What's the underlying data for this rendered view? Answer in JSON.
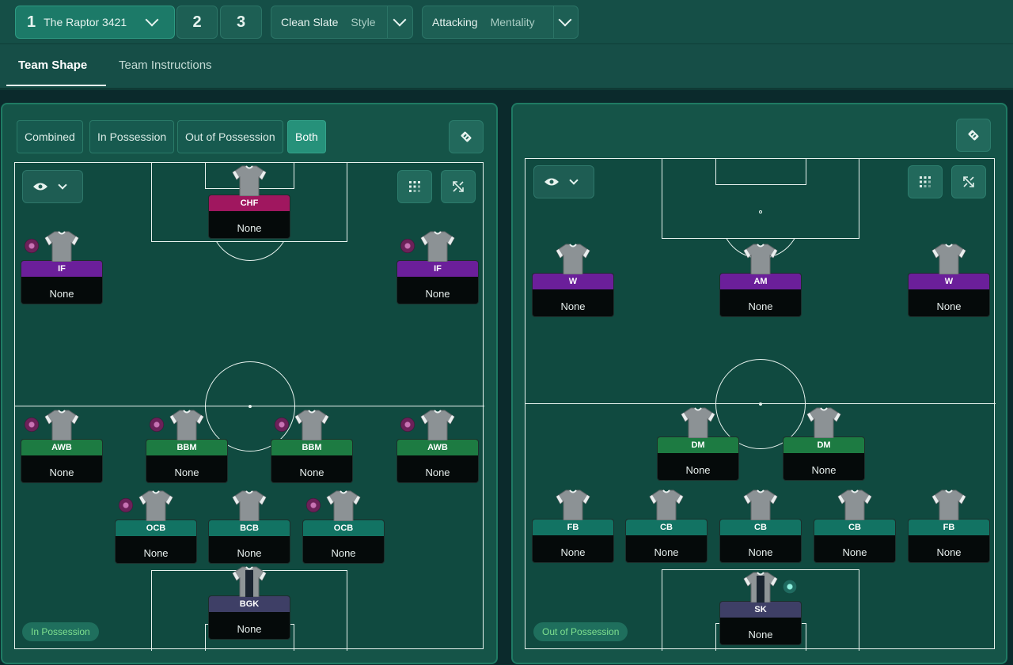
{
  "topbar": {
    "tactic_slot_1": "1",
    "tactic_name": "The Raptor 3421",
    "tactic_slot_2": "2",
    "tactic_slot_3": "3",
    "style_value": "Clean Slate",
    "style_label": "Style",
    "mentality_value": "Attacking",
    "mentality_label": "Mentality"
  },
  "tabs": {
    "team_shape": "Team Shape",
    "team_instructions": "Team Instructions"
  },
  "view_modes": [
    "Combined",
    "In Possession",
    "Out of Possession",
    "Both"
  ],
  "view_modes_selected": "Both",
  "left_pitch": {
    "badge": "In Possession",
    "players": [
      {
        "role": "CHF",
        "name": "None"
      },
      {
        "role": "IF",
        "name": "None"
      },
      {
        "role": "IF",
        "name": "None"
      },
      {
        "role": "AWB",
        "name": "None"
      },
      {
        "role": "BBM",
        "name": "None"
      },
      {
        "role": "BBM",
        "name": "None"
      },
      {
        "role": "AWB",
        "name": "None"
      },
      {
        "role": "OCB",
        "name": "None"
      },
      {
        "role": "BCB",
        "name": "None"
      },
      {
        "role": "OCB",
        "name": "None"
      },
      {
        "role": "BGK",
        "name": "None"
      }
    ]
  },
  "right_pitch": {
    "badge": "Out of Possession",
    "players": [
      {
        "role": "W",
        "name": "None"
      },
      {
        "role": "AM",
        "name": "None"
      },
      {
        "role": "W",
        "name": "None"
      },
      {
        "role": "DM",
        "name": "None"
      },
      {
        "role": "DM",
        "name": "None"
      },
      {
        "role": "FB",
        "name": "None"
      },
      {
        "role": "CB",
        "name": "None"
      },
      {
        "role": "CB",
        "name": "None"
      },
      {
        "role": "CB",
        "name": "None"
      },
      {
        "role": "FB",
        "name": "None"
      },
      {
        "role": "SK",
        "name": "None"
      }
    ]
  },
  "colors": {
    "attack_role": "#6b1f9a",
    "striker_role": "#a0175f",
    "midfield_role": "#1d7b42",
    "defence_role": "#127363",
    "goalkeeper_role": "#3e3f66",
    "badge_text": "#7ee08f"
  },
  "icons": [
    "chevron-down-icon",
    "tactics-board-icon",
    "eye-icon",
    "grid-icon",
    "expand-icon",
    "shirt-icon",
    "duty-icon"
  ]
}
